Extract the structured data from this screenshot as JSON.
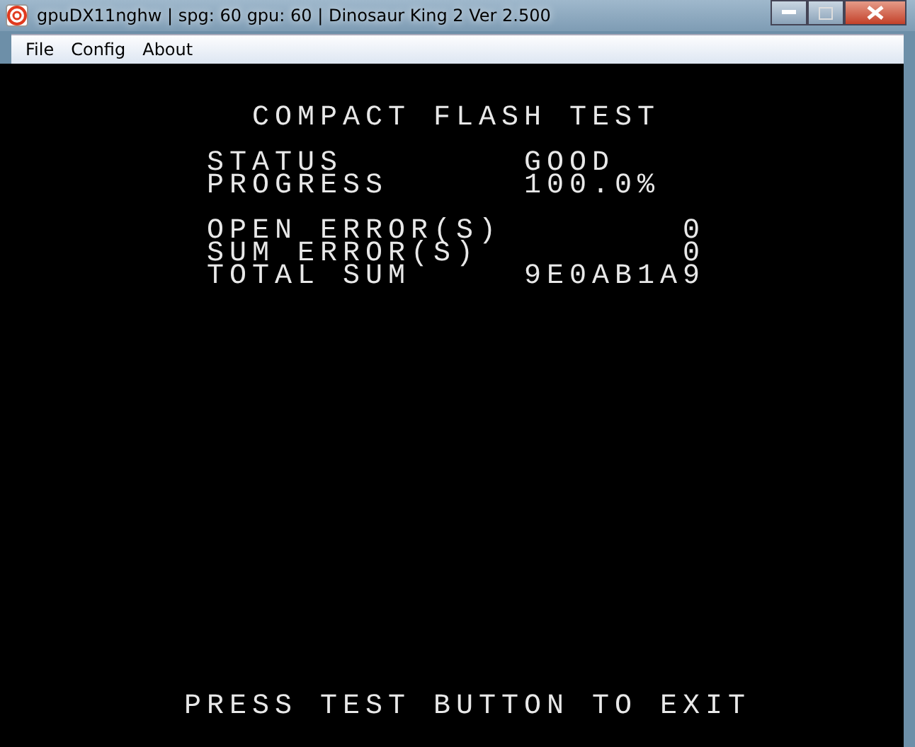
{
  "window": {
    "title": "gpuDX11nghw | spg: 60 gpu: 60 | Dinosaur King 2 Ver 2.500"
  },
  "menu": [
    "File",
    "Config",
    "About"
  ],
  "screen": {
    "heading": "COMPACT FLASH TEST",
    "groups": [
      [
        {
          "label": "STATUS",
          "value": "GOOD"
        },
        {
          "label": "PROGRESS",
          "value": "100.0%"
        }
      ],
      [
        {
          "label": "OPEN ERROR(S)",
          "value": "0"
        },
        {
          "label": "SUM ERROR(S)",
          "value": "0"
        },
        {
          "label": "TOTAL SUM",
          "value": "9E0AB1A9"
        }
      ]
    ],
    "footer": "PRESS TEST BUTTON TO EXIT"
  }
}
